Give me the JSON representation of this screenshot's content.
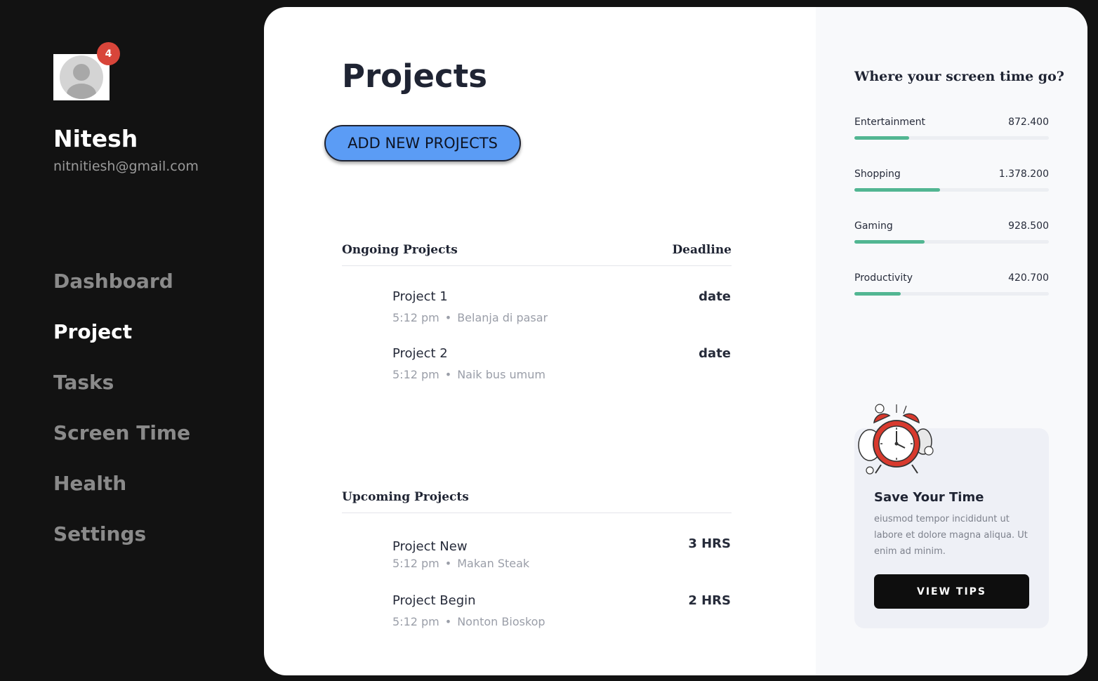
{
  "user": {
    "name": "Nitesh",
    "email": "nitnitiesh@gmail.com",
    "notifications": "4"
  },
  "nav": [
    {
      "label": "Dashboard",
      "active": false
    },
    {
      "label": "Project",
      "active": true
    },
    {
      "label": "Tasks",
      "active": false
    },
    {
      "label": "Screen Time",
      "active": false
    },
    {
      "label": "Health",
      "active": false
    },
    {
      "label": "Settings",
      "active": false
    }
  ],
  "main": {
    "title": "Projects",
    "add_button": "ADD NEW PROJECTS",
    "ongoing": {
      "heading": "Ongoing Projects",
      "column": "Deadline",
      "items": [
        {
          "name": "Project 1",
          "time": "5:12 pm",
          "note": "Belanja di pasar",
          "right": "date"
        },
        {
          "name": "Project 2",
          "time": "5:12 pm",
          "note": "Naik bus umum",
          "right": "date"
        }
      ]
    },
    "upcoming": {
      "heading": "Upcoming Projects",
      "items": [
        {
          "name": "Project New",
          "time": "5:12 pm",
          "note": "Makan Steak",
          "right": "3 HRS"
        },
        {
          "name": "Project Begin",
          "time": "5:12 pm",
          "note": "Nonton Bioskop",
          "right": "2 HRS"
        }
      ]
    }
  },
  "screen_time": {
    "title": "Where your screen time go?",
    "items": [
      {
        "label": "Entertainment",
        "value": "872.400",
        "fill": 0.28
      },
      {
        "label": "Shopping",
        "value": "1.378.200",
        "fill": 0.44
      },
      {
        "label": "Gaming",
        "value": "928.500",
        "fill": 0.36
      },
      {
        "label": "Productivity",
        "value": "420.700",
        "fill": 0.24
      }
    ],
    "bar_color": "#52b692"
  },
  "tips": {
    "title": "Save Your Time",
    "text": "eiusmod tempor incididunt ut labore et dolore magna aliqua. Ut enim ad minim.",
    "button": "VIEW TIPS",
    "icon": "alarm-clock-icon"
  },
  "colors": {
    "accent_button": "#5b9cf5",
    "badge": "#d8453a",
    "sidebar_bg": "#121212"
  }
}
